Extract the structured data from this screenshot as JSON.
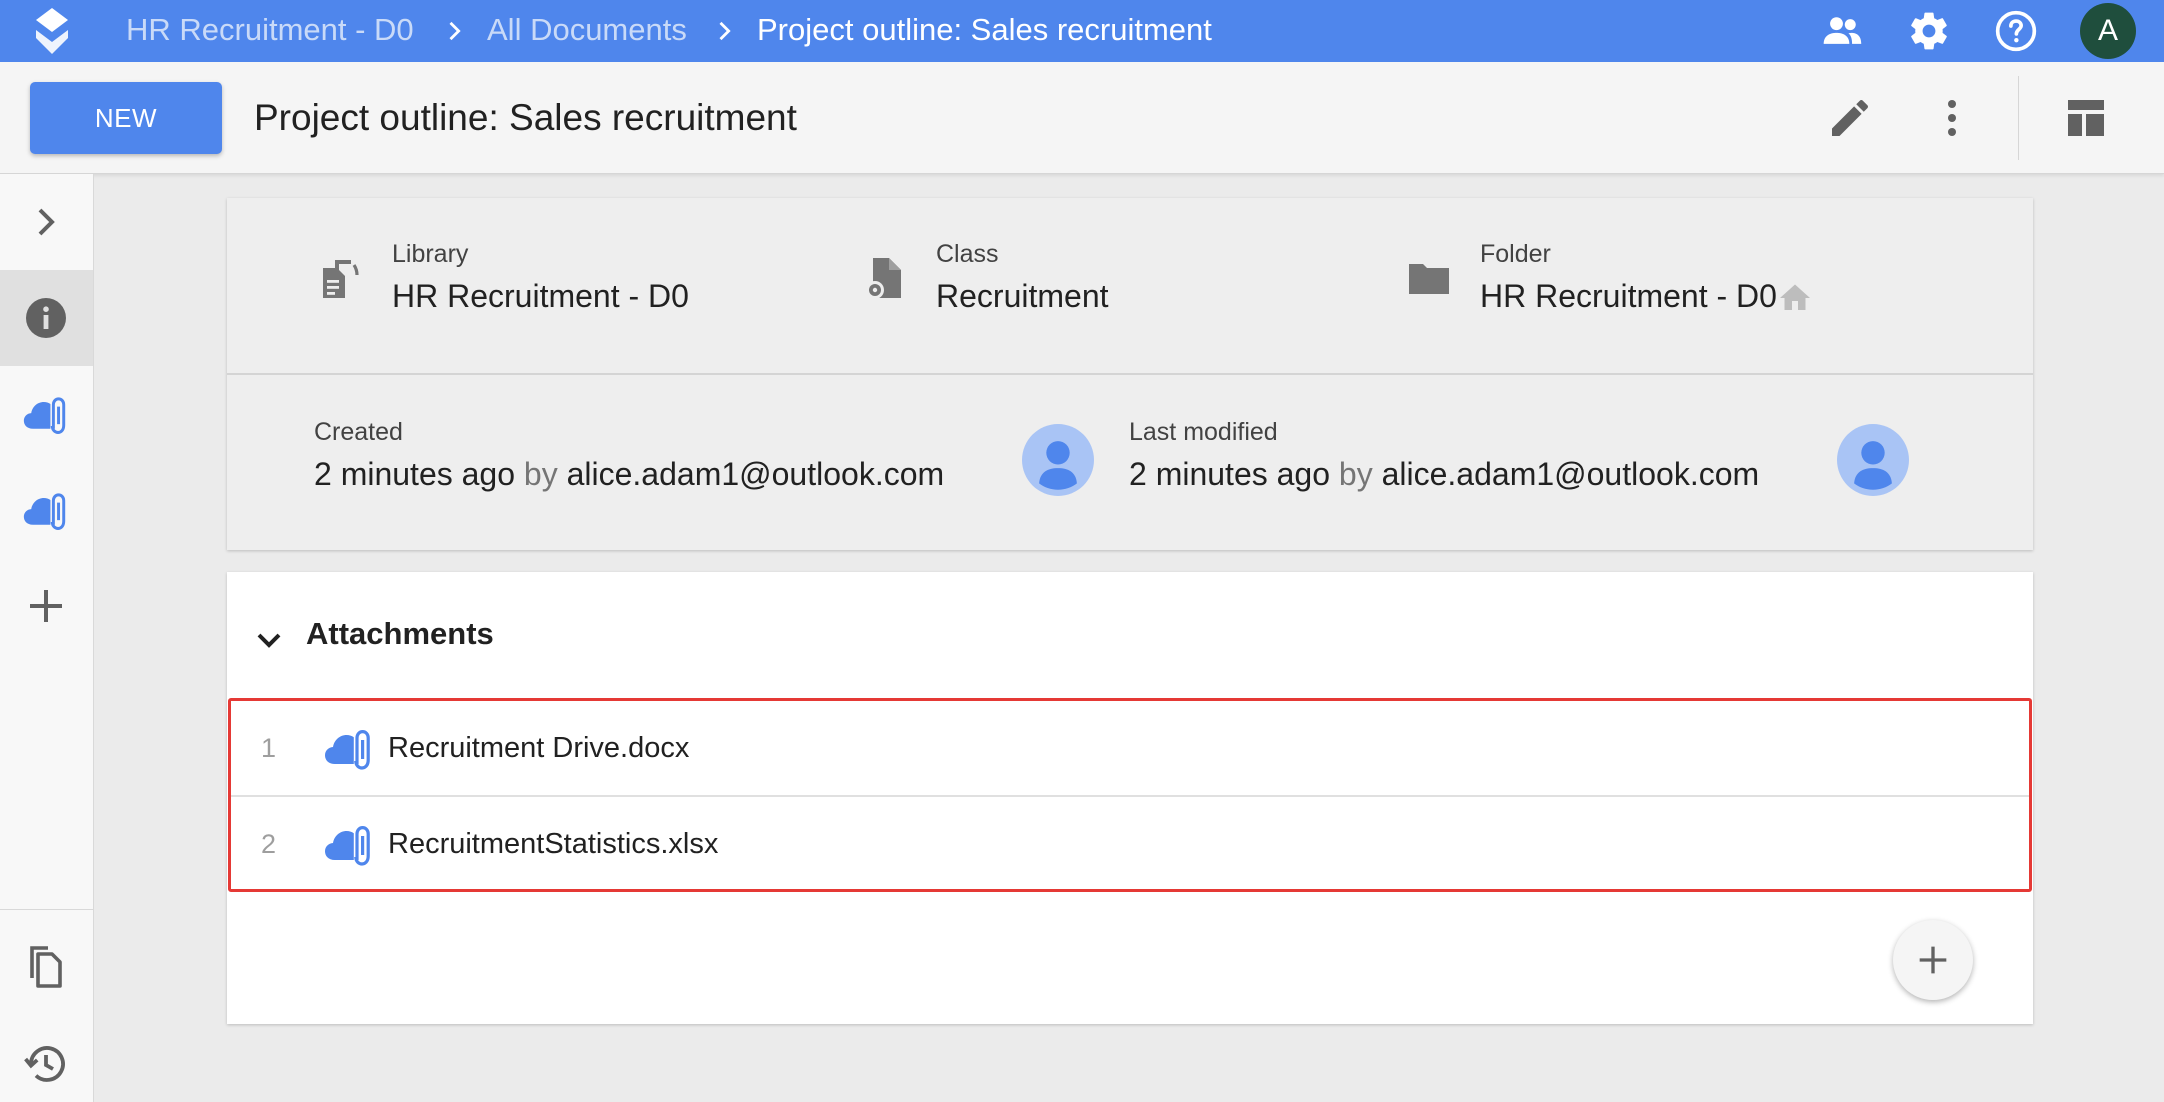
{
  "topbar": {
    "breadcrumbs": [
      "HR Recruitment - D0",
      "All Documents",
      "Project outline: Sales recruitment"
    ],
    "avatar_initial": "A",
    "icons": [
      "app-logo-icon",
      "people-icon",
      "settings-gear-icon",
      "help-icon"
    ]
  },
  "toolbar": {
    "new_label": "NEW",
    "title": "Project outline: Sales recruitment",
    "icons": [
      "edit-pencil-icon",
      "more-vert-icon",
      "layout-panel-icon"
    ]
  },
  "sidebar": {
    "items": [
      {
        "icon": "chevron-right-icon"
      },
      {
        "icon": "info-icon",
        "active": true
      },
      {
        "icon": "cloud-attachment-icon"
      },
      {
        "icon": "cloud-attachment-icon"
      },
      {
        "icon": "plus-icon"
      },
      {
        "icon": "copy-icon"
      },
      {
        "icon": "history-icon"
      }
    ]
  },
  "info": {
    "library": {
      "label": "Library",
      "value": "HR Recruitment - D0"
    },
    "class": {
      "label": "Class",
      "value": "Recruitment"
    },
    "folder": {
      "label": "Folder",
      "value": "HR Recruitment - D0"
    },
    "created": {
      "label": "Created",
      "time": "2 minutes ago",
      "by": "by",
      "user": "alice.adam1@outlook.com"
    },
    "modified": {
      "label": "Last modified",
      "time": "2 minutes ago",
      "by": "by",
      "user": "alice.adam1@outlook.com"
    }
  },
  "attachments": {
    "title": "Attachments",
    "items": [
      {
        "num": "1",
        "name": "Recruitment Drive.docx"
      },
      {
        "num": "2",
        "name": "RecruitmentStatistics.xlsx"
      }
    ]
  },
  "colors": {
    "brand_blue": "#4f86ec",
    "highlight_red": "#e53935"
  }
}
